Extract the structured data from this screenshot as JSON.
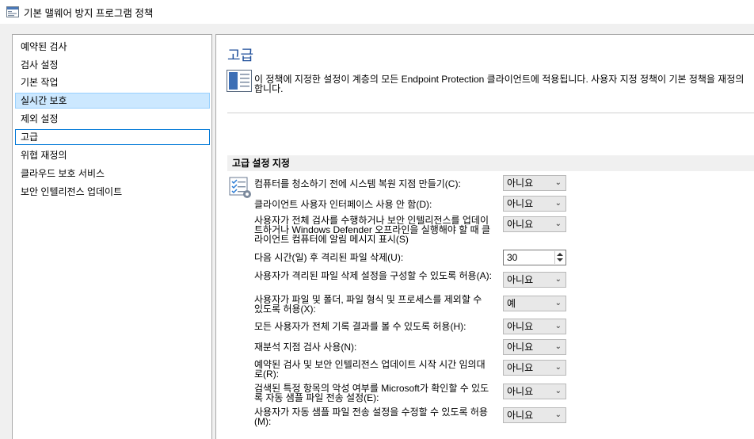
{
  "window": {
    "title": "기본 맬웨어 방지 프로그램 정책",
    "icon": "policy-window-icon"
  },
  "nav": {
    "items": [
      {
        "label": "예약된 검사",
        "state": ""
      },
      {
        "label": "검사 설정",
        "state": ""
      },
      {
        "label": "기본 작업",
        "state": ""
      },
      {
        "label": "실시간 보호",
        "state": "selected"
      },
      {
        "label": "제외 설정",
        "state": ""
      },
      {
        "label": "고급",
        "state": "focused"
      },
      {
        "label": "위협 재정의",
        "state": ""
      },
      {
        "label": "클라우드 보호 서비스",
        "state": ""
      },
      {
        "label": "보안 인텔리전스 업데이트",
        "state": ""
      }
    ]
  },
  "main": {
    "title": "고급",
    "description": "이 정책에 지정한 설정이 계층의 모든 Endpoint Protection 클라이언트에 적용됩니다. 사용자 지정 정책이 기본 정책을 재정의합니다.",
    "section_title": "고급 설정 지정",
    "settings": [
      {
        "label": "컴퓨터를 청소하기 전에 시스템 복원 지점 만들기(C):",
        "type": "dropdown",
        "value": "아니요"
      },
      {
        "label": "클라이언트 사용자 인터페이스 사용 안 함(D):",
        "type": "dropdown",
        "value": "아니요"
      },
      {
        "label": "사용자가 전체 검사를 수행하거나 보안 인텔리전스를 업데이트하거나 Windows Defender 오프라인을 실행해야 할 때 클라이언트 컴퓨터에 알림 메시지 표시(S)",
        "type": "dropdown",
        "value": "아니요"
      },
      {
        "label": "다음 시간(일) 후 격리된 파일 삭제(U):",
        "type": "spinner",
        "value": "30"
      },
      {
        "label": "사용자가 격리된 파일 삭제 설정을 구성할 수 있도록 허용(A):",
        "type": "dropdown",
        "value": "아니요"
      },
      {
        "label": "사용자가 파일 및 폴더, 파일 형식 및 프로세스를 제외할 수 있도록 허용(X):",
        "type": "dropdown",
        "value": "예"
      },
      {
        "label": "모든 사용자가 전체 기록 결과를 볼 수 있도록 허용(H):",
        "type": "dropdown",
        "value": "아니요"
      },
      {
        "label": "재분석 지점 검사 사용(N):",
        "type": "dropdown",
        "value": "아니요"
      },
      {
        "label": "예약된 검사 및 보안 인텔리전스 업데이트 시작 시간 임의대로(R):",
        "type": "dropdown",
        "value": "아니요"
      },
      {
        "label": "검색된 특정 항목의 악성 여부를 Microsoft가 확인할 수 있도록 자동 샘플 파일 전송 설정(E):",
        "type": "dropdown",
        "value": "아니요"
      },
      {
        "label": "사용자가 자동 샘플 파일 전송 설정을 수정할 수 있도록 허용(M):",
        "type": "dropdown",
        "value": "아니요"
      }
    ]
  },
  "colors": {
    "accent_title": "#1e4e9a",
    "selection_fill": "#cce8ff",
    "focus_border": "#0078d7"
  }
}
